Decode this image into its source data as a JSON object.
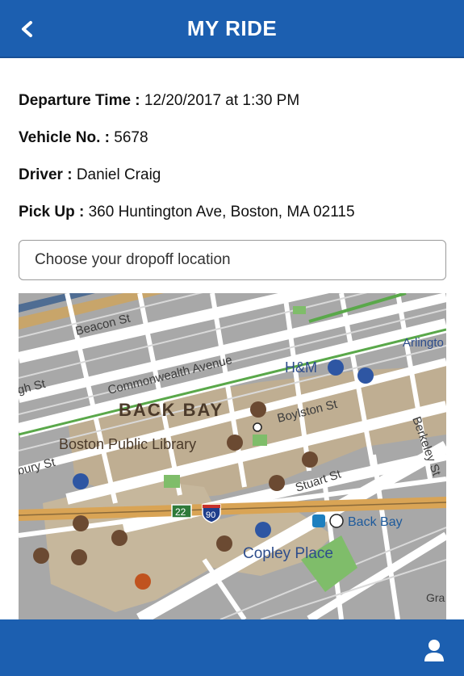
{
  "header": {
    "title": "MY RIDE",
    "back_icon": "chevron-left-icon"
  },
  "ride": {
    "departure_label": "Departure Time :",
    "departure_value": "12/20/2017 at 1:30 PM",
    "vehicle_label": "Vehicle No. :",
    "vehicle_value": "5678",
    "driver_label": "Driver :",
    "driver_value": "Daniel Craig",
    "pickup_label": "Pick Up :",
    "pickup_value": "360 Huntington Ave, Boston, MA 02115"
  },
  "dropoff": {
    "placeholder": "Choose your dropoff location"
  },
  "map": {
    "labels": {
      "beacon": "Beacon St",
      "commonwealth": "Commonwealth Avenue",
      "gh": "gh St",
      "hm": "H&M",
      "arlington": "Arlingto",
      "backbay_area": "BACK BAY",
      "boylston": "Boylston St",
      "library": "Boston Public Library",
      "bury": "bury St",
      "berkeley": "Berkeley St",
      "stuart": "Stuart St",
      "route22": "22",
      "route90": "90",
      "backbay_station": "Back Bay",
      "copley": "Copley Place",
      "gra": "Gra"
    }
  },
  "footer": {
    "profile_icon": "user-icon"
  },
  "colors": {
    "brand_blue": "#1c5fb0",
    "poi_brown": "#6b4a32",
    "poi_blue": "#2e56a3"
  }
}
